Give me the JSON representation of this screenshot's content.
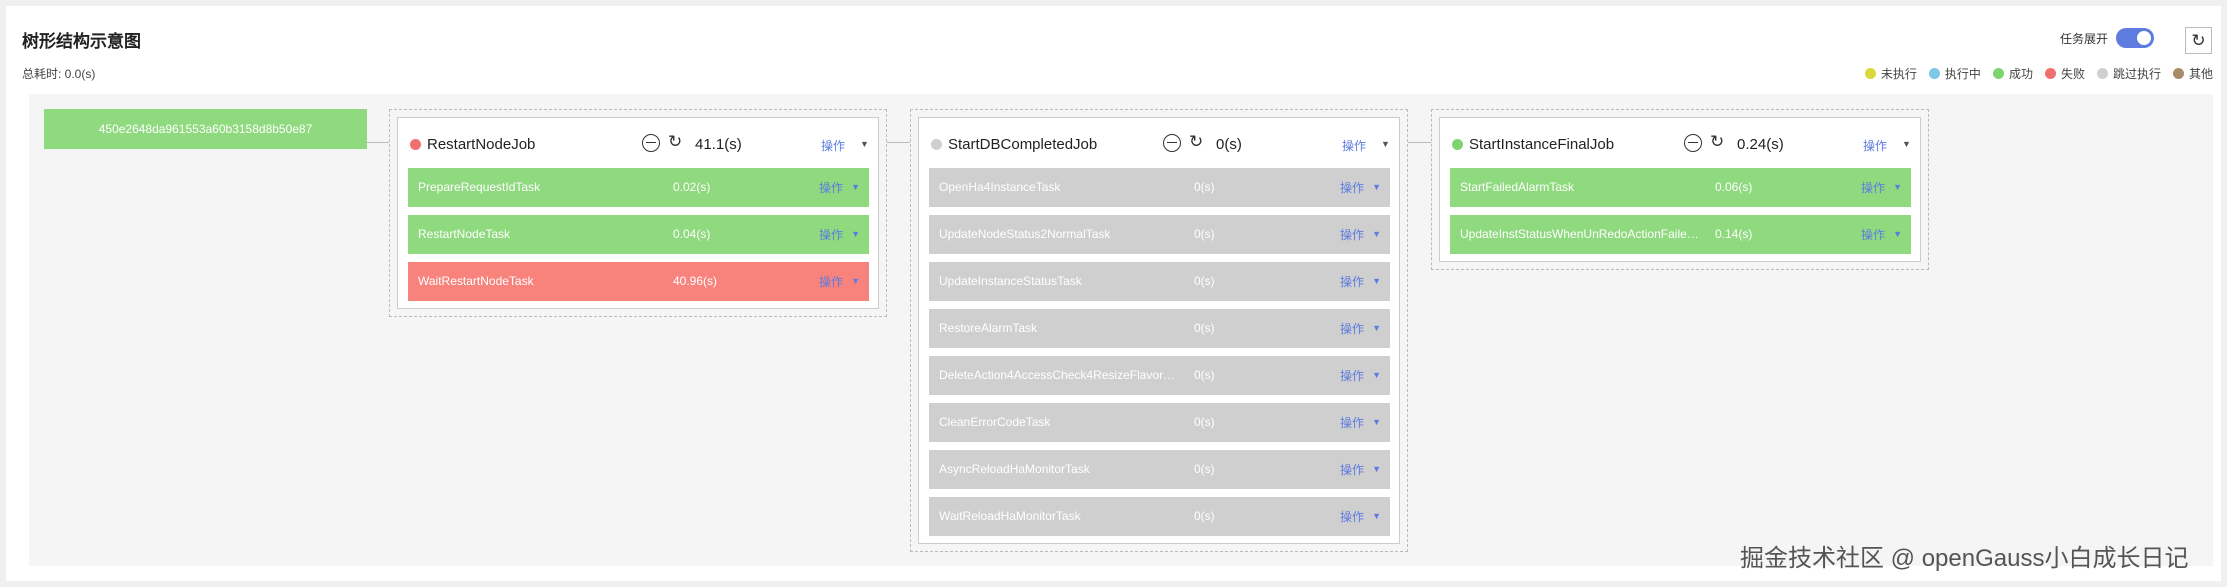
{
  "header": {
    "title": "树形结构示意图",
    "total_time": "总耗时: 0.0(s)",
    "toggle_label": "任务展开",
    "refresh_icon": "refresh-icon"
  },
  "legend": [
    {
      "label": "未执行",
      "color": "#d9d93a"
    },
    {
      "label": "执行中",
      "color": "#7ec8e8"
    },
    {
      "label": "成功",
      "color": "#7fd46f"
    },
    {
      "label": "失败",
      "color": "#f07070"
    },
    {
      "label": "跳过执行",
      "color": "#cfcfcf"
    },
    {
      "label": "其他",
      "color": "#a88c6a"
    }
  ],
  "root": {
    "label": "450e2648da961553a60b3158d8b50e87"
  },
  "jobs": [
    {
      "name": "RestartNodeJob",
      "status_color": "#f07070",
      "time": "41.1(s)",
      "op_label": "操作",
      "tasks": [
        {
          "name": "PrepareRequestIdTask",
          "time": "0.02(s)",
          "op_label": "操作",
          "status": "green"
        },
        {
          "name": "RestartNodeTask",
          "time": "0.04(s)",
          "op_label": "操作",
          "status": "green"
        },
        {
          "name": "WaitRestartNodeTask",
          "time": "40.96(s)",
          "op_label": "操作",
          "status": "red"
        }
      ]
    },
    {
      "name": "StartDBCompletedJob",
      "status_color": "#cfcfcf",
      "time": "0(s)",
      "op_label": "操作",
      "tasks": [
        {
          "name": "OpenHa4InstanceTask",
          "time": "0(s)",
          "op_label": "操作",
          "status": "gray"
        },
        {
          "name": "UpdateNodeStatus2NormalTask",
          "time": "0(s)",
          "op_label": "操作",
          "status": "gray"
        },
        {
          "name": "UpdateInstanceStatusTask",
          "time": "0(s)",
          "op_label": "操作",
          "status": "gray"
        },
        {
          "name": "RestoreAlarmTask",
          "time": "0(s)",
          "op_label": "操作",
          "status": "gray"
        },
        {
          "name": "DeleteAction4AccessCheck4ResizeFlavorT...",
          "time": "0(s)",
          "op_label": "操作",
          "status": "gray"
        },
        {
          "name": "CleanErrorCodeTask",
          "time": "0(s)",
          "op_label": "操作",
          "status": "gray"
        },
        {
          "name": "AsyncReloadHaMonitorTask",
          "time": "0(s)",
          "op_label": "操作",
          "status": "gray"
        },
        {
          "name": "WaitReloadHaMonitorTask",
          "time": "0(s)",
          "op_label": "操作",
          "status": "gray"
        }
      ]
    },
    {
      "name": "StartInstanceFinalJob",
      "status_color": "#7fd46f",
      "time": "0.24(s)",
      "op_label": "操作",
      "tasks": [
        {
          "name": "StartFailedAlarmTask",
          "time": "0.06(s)",
          "op_label": "操作",
          "status": "green"
        },
        {
          "name": "UpdateInstStatusWhenUnRedoActionFailed...",
          "time": "0.14(s)",
          "op_label": "操作",
          "status": "green"
        }
      ]
    }
  ],
  "watermark": "掘金技术社区 @ openGauss小白成长日记"
}
